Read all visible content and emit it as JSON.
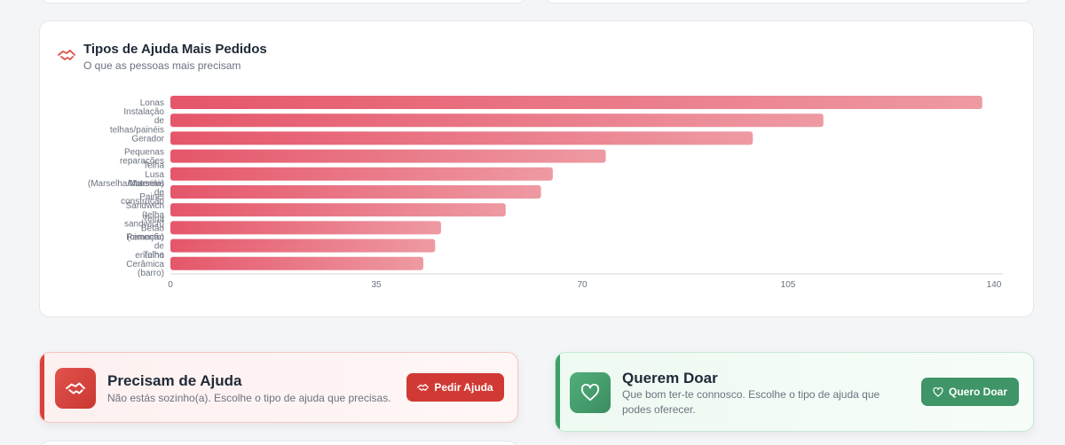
{
  "chart_card": {
    "title": "Tipos de Ajuda Mais Pedidos",
    "subtitle": "O que as pessoas mais precisam",
    "icon": "handshake-icon"
  },
  "chart_data": {
    "type": "bar",
    "orientation": "horizontal",
    "categories": [
      [
        "Lonas"
      ],
      [
        "Instalação",
        "de",
        "telhas/painéis"
      ],
      [
        "Gerador"
      ],
      [
        "Pequenas",
        "reparações"
      ],
      [
        "Telha",
        "Lusa",
        "(Marselha/Marsela)"
      ],
      [
        "Materiais",
        "de",
        "construção"
      ],
      [
        "Painel",
        "Sandwich",
        "(telha",
        "sandwich)"
      ],
      [
        "Telha",
        "Betão",
        "(cimento)"
      ],
      [
        "Remoção",
        "de",
        "entulho"
      ],
      [
        "Telha",
        "Cerâmica",
        "(barro)"
      ]
    ],
    "values": [
      138,
      111,
      99,
      74,
      65,
      63,
      57,
      46,
      45,
      43
    ],
    "xticks": [
      0,
      35,
      70,
      105,
      140
    ],
    "xlim": [
      0,
      140
    ],
    "bar_color_start": "#e5566a",
    "bar_color_end": "#ee9aa3"
  },
  "help_card": {
    "title": "Precisam de Ajuda",
    "text": "Não estás sozinho(a). Escolhe o tipo de ajuda que precisas.",
    "button_label": "Pedir Ajuda",
    "icon": "handshake-icon",
    "accent": "#d13a34"
  },
  "donate_card": {
    "title": "Querem Doar",
    "text": "Que bom ter-te connosco. Escolhe o tipo de ajuda que podes oferecer.",
    "button_label": "Quero Doar",
    "icon": "heart-icon",
    "accent": "#3f9567"
  }
}
